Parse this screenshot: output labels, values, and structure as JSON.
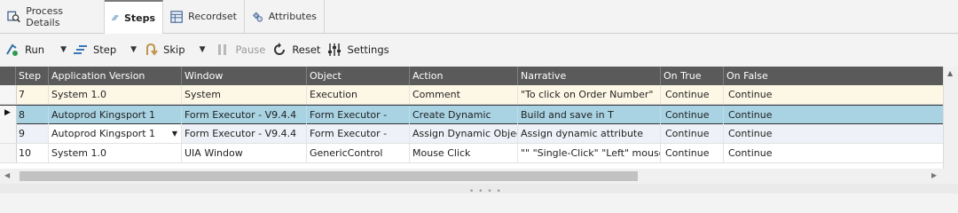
{
  "tabs": [
    {
      "label": "Process Details",
      "icon": "process-details-icon",
      "active": false
    },
    {
      "label": "Steps",
      "icon": "steps-icon",
      "active": true
    },
    {
      "label": "Recordset",
      "icon": "recordset-icon",
      "active": false
    },
    {
      "label": "Attributes",
      "icon": "attributes-icon",
      "active": false
    }
  ],
  "toolbar": {
    "run_label": "Run",
    "step_label": "Step",
    "skip_label": "Skip",
    "pause_label": "Pause",
    "reset_label": "Reset",
    "settings_label": "Settings"
  },
  "grid": {
    "columns": [
      "Step",
      "Application Version",
      "Window",
      "Object",
      "Action",
      "Narrative",
      "On True",
      "On False"
    ],
    "rows": [
      {
        "step": "7",
        "app": "System 1.0",
        "window": "System",
        "object": "Execution",
        "action": "Comment",
        "narrative": "\"To click on Order Number\"",
        "on_true": "Continue",
        "on_false": "Continue",
        "state": "highlight"
      },
      {
        "step": "8",
        "app": "Autoprod Kingsport 1",
        "window": "Form Executor - V9.4.4",
        "object": "Form Executor -",
        "action": "Create Dynamic",
        "narrative": "Build and save in T",
        "on_true": "Continue",
        "on_false": "Continue",
        "state": "selected"
      },
      {
        "step": "9",
        "app": "Autoprod Kingsport 1",
        "window": "Form Executor - V9.4.4",
        "object": "Form Executor -",
        "action": "Assign Dynamic Object",
        "narrative": "Assign dynamic attribute",
        "on_true": "Continue",
        "on_false": "Continue",
        "state": "editing"
      },
      {
        "step": "10",
        "app": "System 1.0",
        "window": "UIA Window",
        "object": "GenericControl",
        "action": "Mouse Click",
        "narrative": "\"\" \"Single-Click\" \"Left\" mouse",
        "on_true": "Continue",
        "on_false": "Continue",
        "state": "normal"
      }
    ]
  },
  "colors": {
    "header_bg": "#5a5a5a",
    "highlight_row": "#fdf8e6",
    "selected_row": "#a9d3e3",
    "editing_row": "#eef1f7"
  }
}
